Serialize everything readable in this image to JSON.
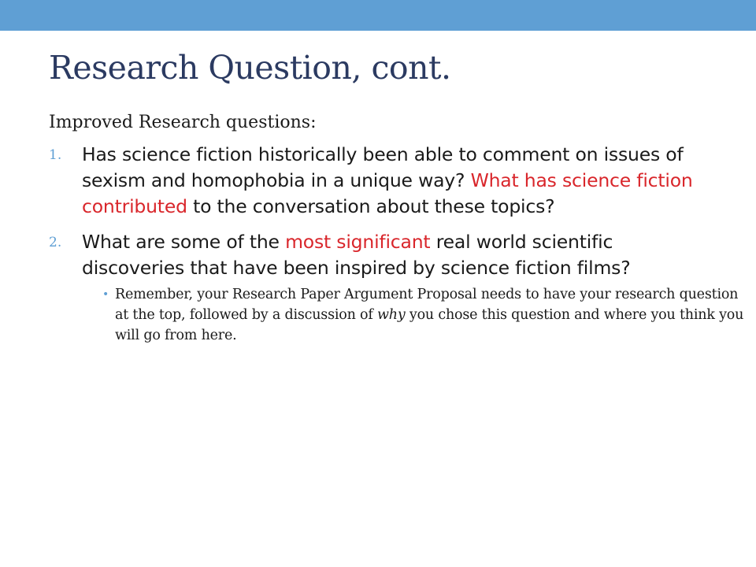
{
  "slide": {
    "title": "Research Question, cont.",
    "intro": "Improved Research questions:",
    "colors": {
      "top_bar": "#5f9fd4",
      "title": "#2b3a61",
      "highlight": "#d9262b",
      "marker": "#5f9fd4"
    },
    "questions": [
      {
        "number": "1.",
        "text_a": "Has science fiction historically been able to comment on issues of sexism and homophobia in a unique way? ",
        "highlight": "What has science fiction contributed",
        "text_b": " to the conversation about these topics?"
      },
      {
        "number": "2.",
        "text_a": "What are some of the ",
        "highlight": "most significant",
        "text_b": " real world scientific discoveries that have been inspired by science fiction films?"
      }
    ],
    "note": {
      "bullet": "•",
      "text_a": "Remember, your Research Paper Argument Proposal needs to have your research question at the top, followed by a discussion of ",
      "emphasis": "why",
      "text_b": " you chose this question and where you think you will go from here."
    }
  }
}
